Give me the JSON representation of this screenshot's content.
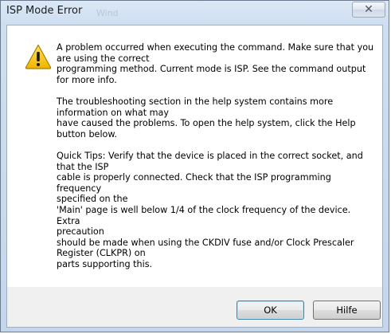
{
  "window": {
    "title": "ISP Mode Error",
    "background_ghost_text": "Wind",
    "close_glyph": "✕"
  },
  "message": {
    "lines": [
      "A problem occurred when executing the command. Make sure that you",
      "are using the correct",
      "programming method. Current mode is ISP. See the command output",
      "for more info.",
      "",
      "The troubleshooting section in the help system contains more",
      "information on what may",
      "have caused the problems. To open the help system, click the Help",
      "button below.",
      "",
      "Quick Tips: Verify that the device is placed in the correct socket, and",
      "that the ISP",
      "cable is properly connected. Check that the ISP programming frequency",
      "specified on the",
      "'Main' page is well below 1/4 of the clock frequency of the device. Extra",
      "precaution",
      "should be made when using the CKDIV fuse and/or Clock Prescaler",
      "Register (CLKPR) on",
      "parts supporting this."
    ]
  },
  "buttons": {
    "ok_label": "OK",
    "help_label": "Hilfe"
  },
  "icons": {
    "warning": "warning-icon",
    "close": "close-icon"
  },
  "colors": {
    "warning_fill": "#f5c400",
    "warning_border": "#b68a00",
    "ok_focus_border": "#3c7fb1"
  }
}
